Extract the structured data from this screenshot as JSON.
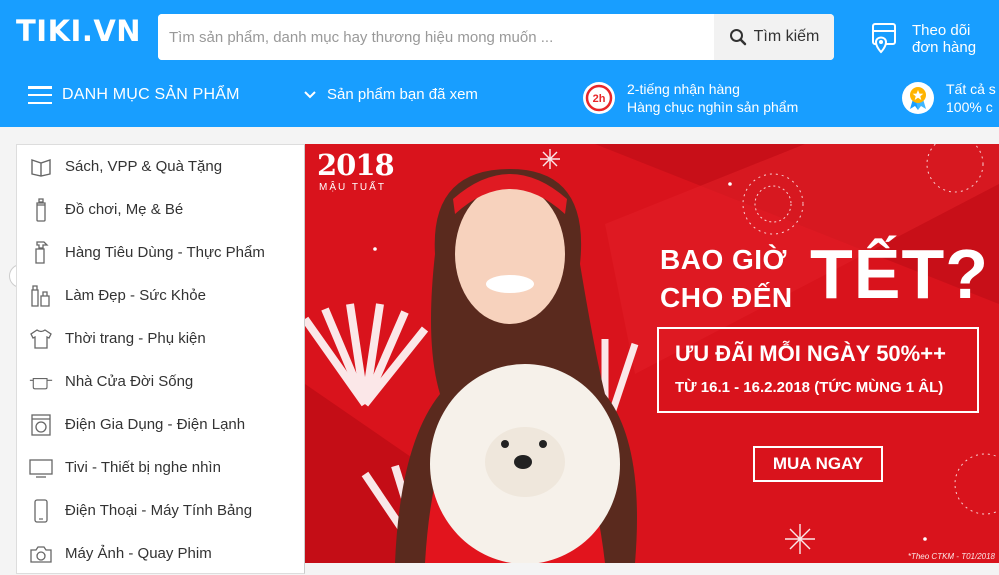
{
  "header": {
    "logo": "TIKI.VN",
    "search": {
      "placeholder": "Tìm sản phẩm, danh mục hay thương hiệu mong muốn ...",
      "button_label": "Tìm kiếm"
    },
    "track_order": {
      "line1": "Theo dõi",
      "line2": "đơn hàng"
    }
  },
  "navbar": {
    "category_menu_label": "DANH MỤC SẢN PHẨM",
    "viewed_products_label": "Sản phẩm bạn đã xem",
    "promos": [
      {
        "icon": "2h-delivery-icon",
        "badge": "2h",
        "line1": "2-tiếng nhận hàng",
        "line2": "Hàng chục nghìn sản phẩm"
      },
      {
        "icon": "medal-icon",
        "line1": "Tất cả s",
        "line2": "100% c"
      }
    ]
  },
  "categories": [
    {
      "label": "Sách, VPP & Quà Tặng",
      "icon": "book-icon"
    },
    {
      "label": "Đồ chơi, Mẹ & Bé",
      "icon": "baby-bottle-icon"
    },
    {
      "label": "Hàng Tiêu Dùng - Thực Phẩm",
      "icon": "spray-bottle-icon"
    },
    {
      "label": "Làm Đẹp - Sức Khỏe",
      "icon": "cosmetics-icon"
    },
    {
      "label": "Thời trang - Phụ kiện",
      "icon": "shirt-icon"
    },
    {
      "label": "Nhà Cửa Đời Sống",
      "icon": "cooking-pot-icon"
    },
    {
      "label": "Điện Gia Dụng - Điện Lạnh",
      "icon": "washing-machine-icon"
    },
    {
      "label": "Tivi - Thiết bị nghe nhìn",
      "icon": "tv-icon"
    },
    {
      "label": "Điện Thoại - Máy Tính Bảng",
      "icon": "phone-icon"
    },
    {
      "label": "Máy Ảnh - Quay Phim",
      "icon": "camera-icon"
    }
  ],
  "banner": {
    "year": "2018",
    "year_subtitle": "MẬU TUẤT",
    "headline_line1": "BAO GIỜ",
    "headline_line2": "CHO ĐẾN",
    "headline_big": "TẾT?",
    "offer_line1": "ƯU ĐÃI MỖI NGÀY 50%++",
    "offer_line2": "TỪ 16.1 - 16.2.2018 (TỨC MÙNG 1 ÂL)",
    "cta_label": "MUA NGAY",
    "footnote": "*Theo CTKM - T01/2018",
    "colors": {
      "banner_red": "#d9131c",
      "header_blue": "#189eff"
    }
  }
}
